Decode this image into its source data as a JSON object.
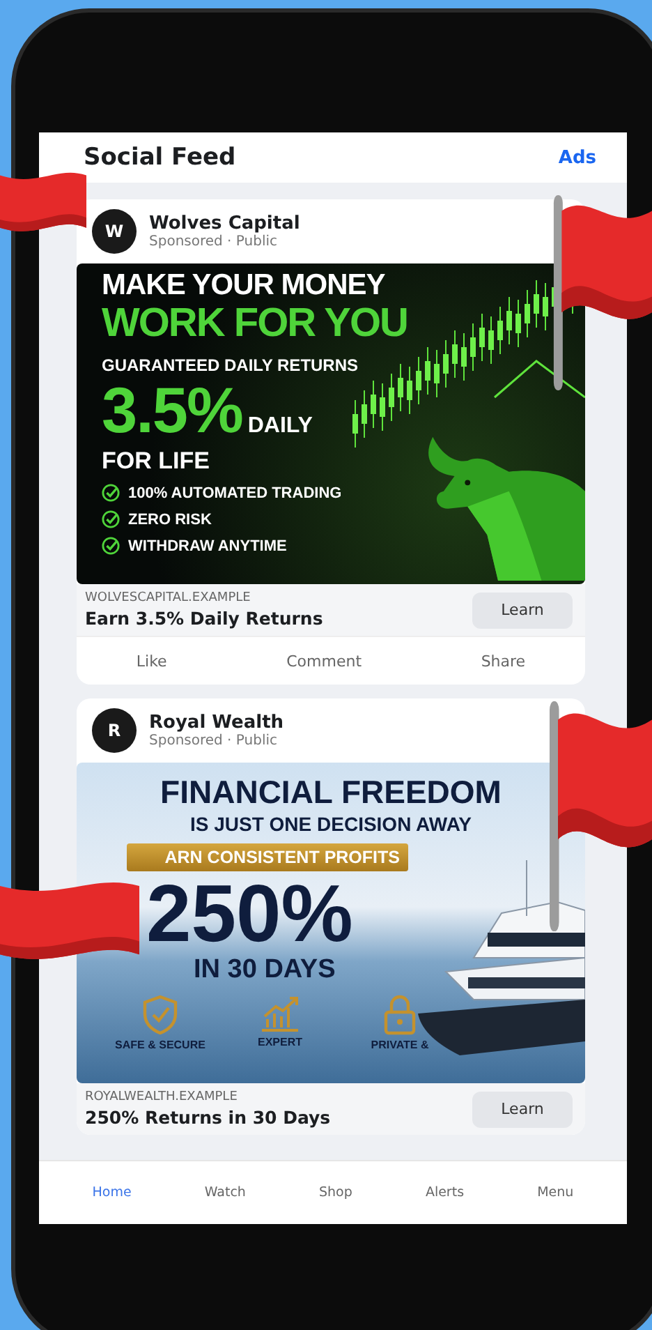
{
  "header": {
    "title": "Social Feed",
    "link": "Ads"
  },
  "posts": [
    {
      "avatar": "W",
      "name": "Wolves Capital",
      "meta": "Sponsored · Public",
      "creative": {
        "kind": "trading",
        "line_1": "MAKE YOUR MONEY",
        "line_2": "WORK FOR YOU",
        "subtitle": "GUARANTEED DAILY RETURNS",
        "figure": "3.5%",
        "figure_suffix": "DAILY",
        "tagline": "FOR LIFE",
        "bullets": [
          "100% AUTOMATED TRADING",
          "ZERO RISK",
          "WITHDRAW ANYTIME"
        ]
      },
      "domain": "WOLVESCAPITAL.EXAMPLE",
      "headline": "Earn 3.5% Daily Returns",
      "button": "Learn",
      "actions": [
        "Like",
        "Comment",
        "Share"
      ]
    },
    {
      "avatar": "R",
      "name": "Royal Wealth",
      "meta": "Sponsored · Public",
      "creative": {
        "kind": "yacht",
        "line_1": "FINANCIAL FREEDOM",
        "line_2": "IS JUST ONE DECISION AWAY",
        "banner": "ARN CONSISTENT PROFITS",
        "figure": "250%",
        "tagline": "IN 30 DAYS",
        "features": [
          {
            "kind": "shield",
            "label": "SAFE & SECURE"
          },
          {
            "kind": "chart",
            "label": "EXPERT"
          },
          {
            "kind": "lock",
            "label": "PRIVATE &"
          }
        ]
      },
      "domain": "ROYALWEALTH.EXAMPLE",
      "headline": "250% Returns in 30 Days",
      "button": "Learn"
    }
  ],
  "nav": [
    {
      "label": "Home",
      "selected": true
    },
    {
      "label": "Watch",
      "selected": false
    },
    {
      "label": "Shop",
      "selected": false
    },
    {
      "label": "Alerts",
      "selected": false
    },
    {
      "label": "Menu",
      "selected": false
    }
  ]
}
